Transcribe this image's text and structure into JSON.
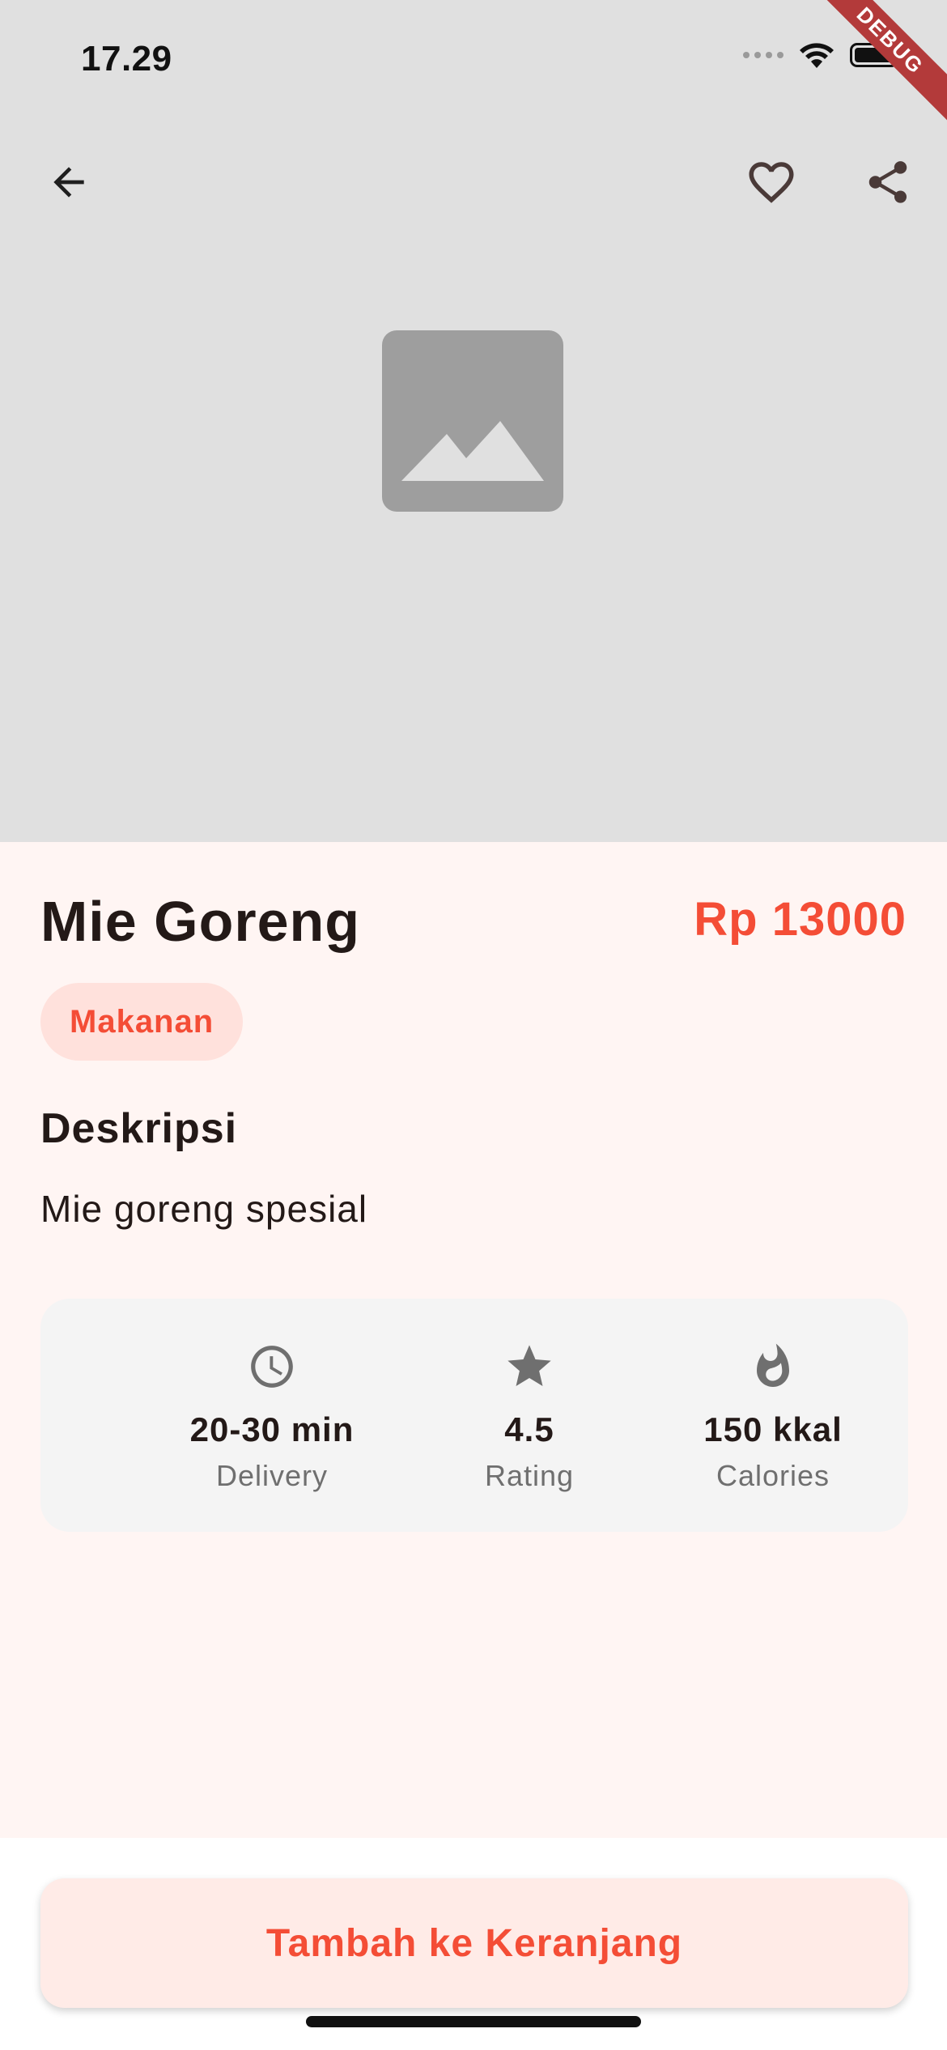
{
  "status_bar": {
    "time": "17.29",
    "debug_label": "DEBUG"
  },
  "header": {
    "icons": [
      "back-arrow-icon",
      "heart-outline-icon",
      "share-icon"
    ]
  },
  "product": {
    "name": "Mie Goreng",
    "price": "Rp 13000",
    "category": "Makanan",
    "description_title": "Deskripsi",
    "description": "Mie goreng spesial"
  },
  "info": [
    {
      "icon": "clock-icon",
      "value": "20-30 min",
      "label": "Delivery"
    },
    {
      "icon": "star-icon",
      "value": "4.5",
      "label": "Rating"
    },
    {
      "icon": "flame-icon",
      "value": "150 kkal",
      "label": "Calories"
    }
  ],
  "actions": {
    "add_to_cart": "Tambah ke Keranjang"
  },
  "colors": {
    "accent": "#f44d36",
    "chip_bg": "#ffe1dc",
    "content_bg": "#fff5f3",
    "hero_bg": "#e0e0e0"
  }
}
